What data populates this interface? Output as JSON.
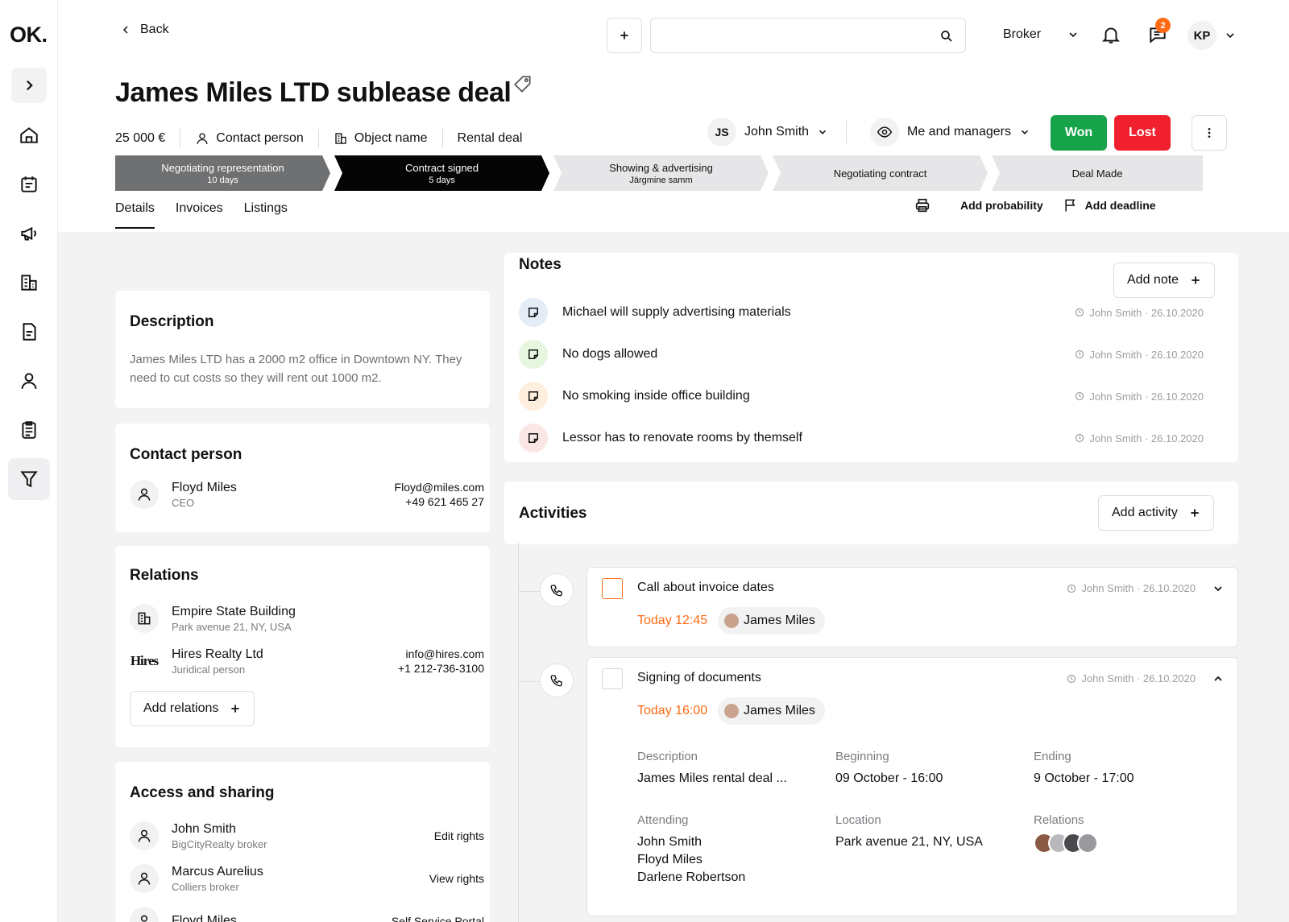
{
  "app": {
    "logo": "OK."
  },
  "topbar": {
    "back": "Back",
    "search_placeholder": "",
    "role": "Broker",
    "notifications_badge": "2",
    "user_initials": "KP"
  },
  "deal": {
    "title": "James Miles LTD sublease deal",
    "price": "25 000 €",
    "contact": "Contact person",
    "object": "Object name",
    "type": "Rental deal",
    "owner_initials": "JS",
    "owner_name": "John Smith",
    "visibility": "Me and managers",
    "won": "Won",
    "lost": "Lost"
  },
  "pipeline": [
    {
      "label": "Negotiating representation",
      "sub": "10 days"
    },
    {
      "label": "Contract signed",
      "sub": "5 days"
    },
    {
      "label": "Showing & advertising",
      "sub": "Järgmine samm"
    },
    {
      "label": "Negotiating contract",
      "sub": ""
    },
    {
      "label": "Deal Made",
      "sub": ""
    }
  ],
  "tabs": [
    "Details",
    "Invoices",
    "Listings"
  ],
  "tools": {
    "probability": "Add probability",
    "deadline": "Add deadline"
  },
  "description": {
    "title": "Description",
    "text": "James Miles LTD has a 2000 m2 office in Downtown NY. They need to cut costs so they will rent out 1000 m2."
  },
  "contact_person": {
    "title": "Contact person",
    "name": "Floyd Miles",
    "role": "CEO",
    "email": "Floyd@miles.com",
    "phone": "+49 621 465 27"
  },
  "relations": {
    "title": "Relations",
    "items": [
      {
        "name": "Empire State Building",
        "sub": "Park avenue 21, NY, USA"
      },
      {
        "name": "Hires Realty Ltd",
        "sub": "Juridical person",
        "logo": "Hires",
        "email": "info@hires.com",
        "phone": "+1 212-736-3100"
      }
    ],
    "add": "Add relations"
  },
  "access": {
    "title": "Access and sharing",
    "items": [
      {
        "name": "John Smith",
        "sub": "BigCityRealty broker",
        "right": "Edit rights"
      },
      {
        "name": "Marcus Aurelius",
        "sub": "Colliers broker",
        "right": "View rights"
      },
      {
        "name": "Floyd Miles",
        "sub": "",
        "right": "Self Service Portal"
      }
    ]
  },
  "notes": {
    "title": "Notes",
    "add": "Add note",
    "items": [
      {
        "text": "Michael will supply advertising materials",
        "meta": "John Smith · 26.10.2020",
        "color": "#e4ecf7"
      },
      {
        "text": "No dogs allowed",
        "meta": "John Smith · 26.10.2020",
        "color": "#e7f6df"
      },
      {
        "text": "No smoking inside office building",
        "meta": "John Smith · 26.10.2020",
        "color": "#fdeedd"
      },
      {
        "text": "Lessor has to renovate rooms by themself",
        "meta": "John Smith · 26.10.2020",
        "color": "#fbe6e6"
      }
    ]
  },
  "activities": {
    "title": "Activities",
    "add": "Add activity",
    "items": [
      {
        "title": "Call about invoice dates",
        "meta": "John Smith · 26.10.2020",
        "time": "Today 12:45",
        "attendee": "James Miles"
      },
      {
        "title": "Signing of documents",
        "meta": "John Smith · 26.10.2020",
        "time": "Today 16:00",
        "attendee": "James Miles",
        "details": {
          "description_label": "Description",
          "description": "James Miles rental deal ...",
          "beginning_label": "Beginning",
          "beginning": "09 October - 16:00",
          "ending_label": "Ending",
          "ending": "9 October - 17:00",
          "attending_label": "Attending",
          "attending": [
            "John Smith",
            "Floyd Miles",
            "Darlene Robertson"
          ],
          "location_label": "Location",
          "location": "Park avenue 21, NY, USA",
          "relations_label": "Relations"
        }
      }
    ]
  },
  "colors": {
    "won": "#17a34a",
    "lost": "#f0202e",
    "accent": "#ff6a13",
    "stage_done": "#6f7072",
    "stage_current": "#050505",
    "stage_todo": "#e6e6e9"
  }
}
